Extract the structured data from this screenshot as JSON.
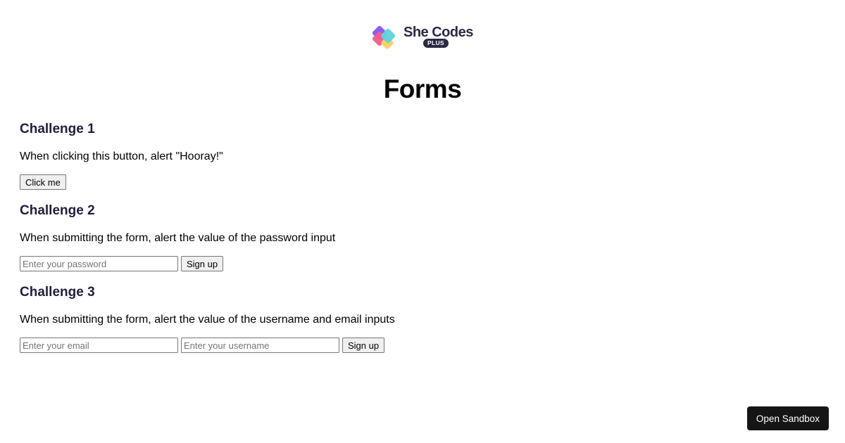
{
  "logo": {
    "brand": "She Codes",
    "badge": "PLUS"
  },
  "page_title": "Forms",
  "challenges": [
    {
      "heading": "Challenge 1",
      "description": "When clicking this button, alert \"Hooray!\"",
      "button_label": "Click me"
    },
    {
      "heading": "Challenge 2",
      "description": "When submitting the form, alert the value of the password input",
      "password_placeholder": "Enter your password",
      "password_value": "",
      "button_label": "Sign up"
    },
    {
      "heading": "Challenge 3",
      "description": "When submitting the form, alert the value of the username and email inputs",
      "email_placeholder": "Enter your email",
      "email_value": "",
      "username_placeholder": "Enter your username",
      "username_value": "",
      "button_label": "Sign up"
    }
  ],
  "sandbox_button": "Open Sandbox",
  "colors": {
    "heading": "#1f1e3d",
    "brand_dark": "#2b2a45",
    "logo_pink": "#f25c8c",
    "logo_purple": "#8b5cf6",
    "logo_cyan": "#5ed3db",
    "logo_yellow": "#ffd166",
    "sandbox_bg": "#151515"
  }
}
